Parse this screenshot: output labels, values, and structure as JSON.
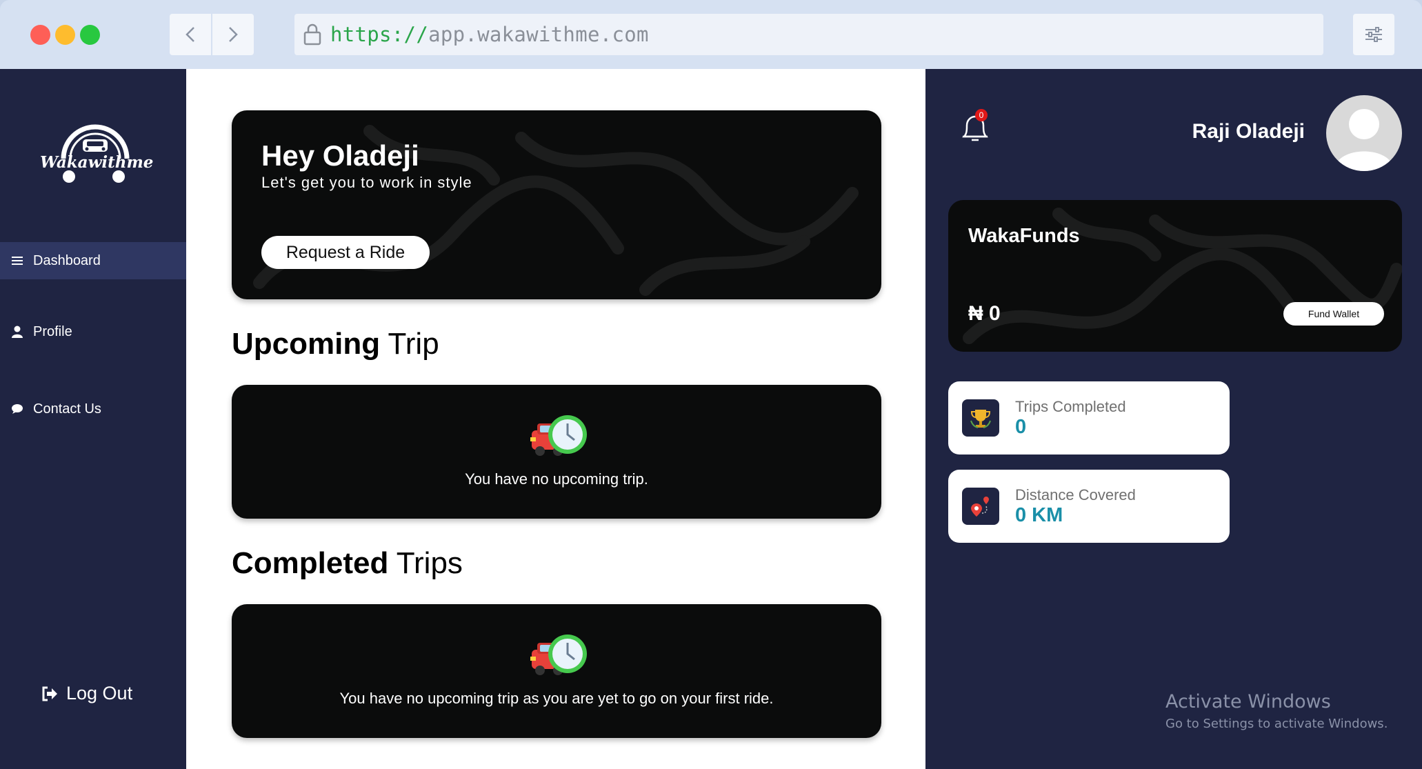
{
  "browser": {
    "url_protocol": "https://",
    "url_host": "app.wakawithme.com"
  },
  "sidebar": {
    "logo_text": "Wakawithme",
    "items": [
      {
        "label": "Dashboard",
        "icon": "menu-icon",
        "active": true
      },
      {
        "label": "Profile",
        "icon": "user-icon",
        "active": false
      },
      {
        "label": "Contact Us",
        "icon": "chat-bubble-icon",
        "active": false
      }
    ],
    "logout_label": "Log Out"
  },
  "hero": {
    "greeting": "Hey Oladeji",
    "subtitle": "Let's get you to work in style",
    "button_label": "Request a Ride"
  },
  "upcoming": {
    "title_bold": "Upcoming",
    "title_rest": " Trip",
    "empty_message": "You have no upcoming trip."
  },
  "completed": {
    "title_bold": "Completed",
    "title_rest": " Trips",
    "empty_message": "You have no upcoming trip as you are yet to go on your first ride."
  },
  "header": {
    "notification_count": "0",
    "user_name": "Raji Oladeji"
  },
  "wallet": {
    "title": "WakaFunds",
    "amount": "₦ 0",
    "fund_button_label": "Fund Wallet"
  },
  "stats": [
    {
      "label": "Trips Completed",
      "value": "0",
      "icon": "trophy-icon"
    },
    {
      "label": "Distance Covered",
      "value": "0 KM",
      "icon": "route-pin-icon"
    }
  ],
  "watermark": {
    "line1": "Activate Windows",
    "line2": "Go to Settings to activate Windows."
  },
  "colors": {
    "sidebar_bg": "#1f2442",
    "card_bg": "#0b0c0c",
    "accent_value": "#1a8fa8",
    "active_nav": "#2f3762"
  }
}
